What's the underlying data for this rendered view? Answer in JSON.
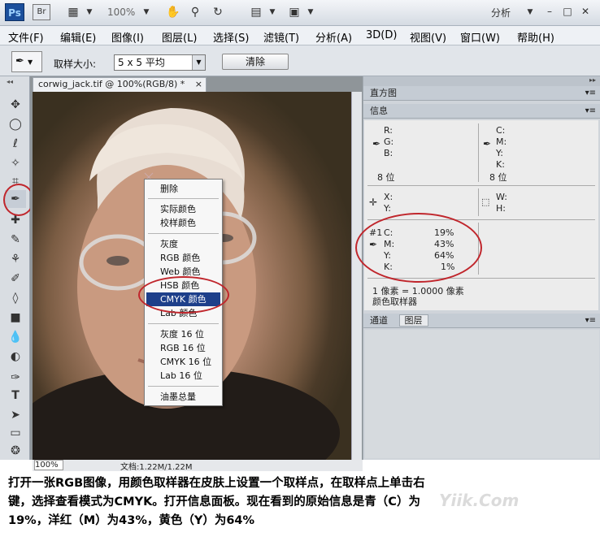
{
  "appbar": {
    "logo": "Ps",
    "bridge": "Br",
    "zoom": "100%",
    "workspace": "分析"
  },
  "menu": [
    "文件(F)",
    "编辑(E)",
    "图像(I)",
    "图层(L)",
    "选择(S)",
    "滤镜(T)",
    "分析(A)",
    "3D(D)",
    "视图(V)",
    "窗口(W)",
    "帮助(H)"
  ],
  "options": {
    "sample_label": "取样大小:",
    "sample_value": "5 x 5 平均",
    "clear_label": "清除"
  },
  "document": {
    "tab": "corwig_jack.tif @ 100%(RGB/8) *",
    "close": "×",
    "zoom": "100%",
    "doc_size": "文档:1.22M/1.22M"
  },
  "context_menu": [
    "删除",
    "实际颜色",
    "校样颜色",
    "灰度",
    "RGB 颜色",
    "Web 颜色",
    "HSB 颜色",
    "CMYK 颜色",
    "Lab 颜色",
    "灰度 16 位",
    "RGB 16 位",
    "CMYK 16 位",
    "Lab 16 位",
    "油墨总量"
  ],
  "panels": {
    "histogram": "直方图",
    "info": "信息",
    "channels": "通道",
    "layers": "图层"
  },
  "info": {
    "rgb_labels": [
      "R:",
      "G:",
      "B:"
    ],
    "cmyk_labels": [
      "C:",
      "M:",
      "Y:",
      "K:"
    ],
    "bits_left": "8 位",
    "bits_right": "8 位",
    "xy": [
      "X:",
      "Y:"
    ],
    "wh": [
      "W:",
      "H:"
    ],
    "sample": {
      "id": "#1",
      "labels": [
        "C:",
        "M:",
        "Y:",
        "K:"
      ],
      "values": [
        "19%",
        "43%",
        "64%",
        "1%"
      ]
    },
    "pixel_ratio": "1 像素 = 1.0000 像素",
    "tool_name": "颜色取样器"
  },
  "caption": [
    "打开一张RGB图像，用颜色取样器在皮肤上设置一个取样点，在取样点上单击右",
    "键，选择查看模式为CMYK。打开信息面板。现在看到的原始信息是青（C）为",
    "19%，洋红（M）为43%，黄色（Y）为64%"
  ],
  "watermark": "Yiik.Com"
}
